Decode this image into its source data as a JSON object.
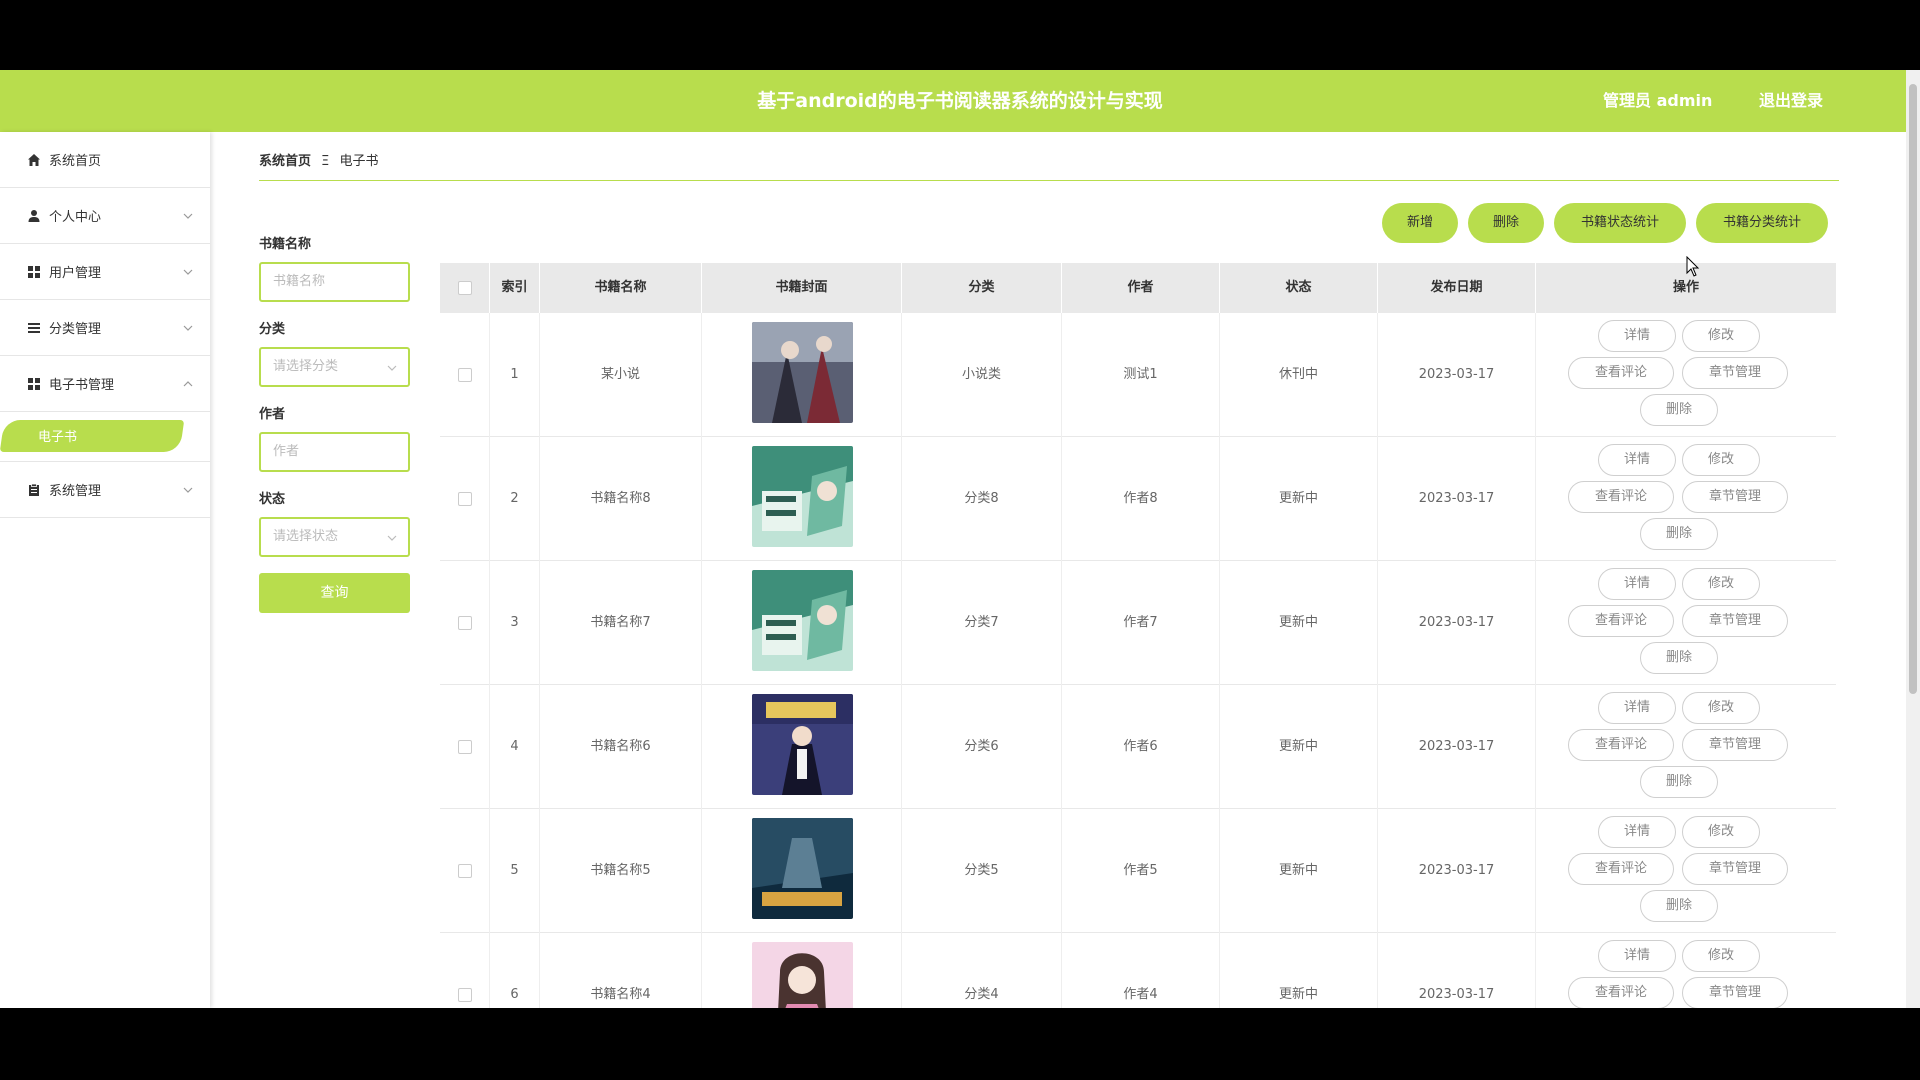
{
  "header": {
    "title": "基于android的电子书阅读器系统的设计与实现",
    "user": "管理员 admin",
    "logout": "退出登录"
  },
  "sidebar": {
    "items": [
      {
        "label": "系统首页",
        "icon": "home-icon"
      },
      {
        "label": "个人中心",
        "icon": "user-icon"
      },
      {
        "label": "用户管理",
        "icon": "grid-icon"
      },
      {
        "label": "分类管理",
        "icon": "list-icon"
      },
      {
        "label": "电子书管理",
        "icon": "grid-icon",
        "expanded": true
      },
      {
        "label": "系统管理",
        "icon": "clipboard-icon"
      }
    ],
    "active_sub": "电子书"
  },
  "breadcrumb": {
    "home": "系统首页",
    "current": "电子书"
  },
  "filters": {
    "name_label": "书籍名称",
    "name_placeholder": "书籍名称",
    "category_label": "分类",
    "category_placeholder": "请选择分类",
    "author_label": "作者",
    "author_placeholder": "作者",
    "status_label": "状态",
    "status_placeholder": "请选择状态",
    "query": "查询"
  },
  "toolbar": {
    "add": "新增",
    "delete": "删除",
    "status_stats": "书籍状态统计",
    "category_stats": "书籍分类统计"
  },
  "table": {
    "headers": [
      "索引",
      "书籍名称",
      "书籍封面",
      "分类",
      "作者",
      "状态",
      "发布日期",
      "操作"
    ],
    "actions": {
      "detail": "详情",
      "edit": "修改",
      "comments": "查看评论",
      "chapters": "章节管理",
      "delete": "删除"
    },
    "rows": [
      {
        "index": "1",
        "name": "某小说",
        "category": "小说类",
        "author": "测试1",
        "status": "休刊中",
        "date": "2023-03-17",
        "cover": "cover-dark-fantasy"
      },
      {
        "index": "2",
        "name": "书籍名称8",
        "category": "分类8",
        "author": "作者8",
        "status": "更新中",
        "date": "2023-03-17",
        "cover": "cover-green-anime"
      },
      {
        "index": "3",
        "name": "书籍名称7",
        "category": "分类7",
        "author": "作者7",
        "status": "更新中",
        "date": "2023-03-17",
        "cover": "cover-green-anime"
      },
      {
        "index": "4",
        "name": "书籍名称6",
        "category": "分类6",
        "author": "作者6",
        "status": "更新中",
        "date": "2023-03-17",
        "cover": "cover-purple-suit"
      },
      {
        "index": "5",
        "name": "书籍名称5",
        "category": "分类5",
        "author": "作者5",
        "status": "更新中",
        "date": "2023-03-17",
        "cover": "cover-dark-blue"
      },
      {
        "index": "6",
        "name": "书籍名称4",
        "category": "分类4",
        "author": "作者4",
        "status": "更新中",
        "date": "2023-03-17",
        "cover": "cover-pink-girl"
      }
    ]
  },
  "colors": {
    "accent": "#b8dd4d",
    "header_bg": "#e9e9e9"
  }
}
